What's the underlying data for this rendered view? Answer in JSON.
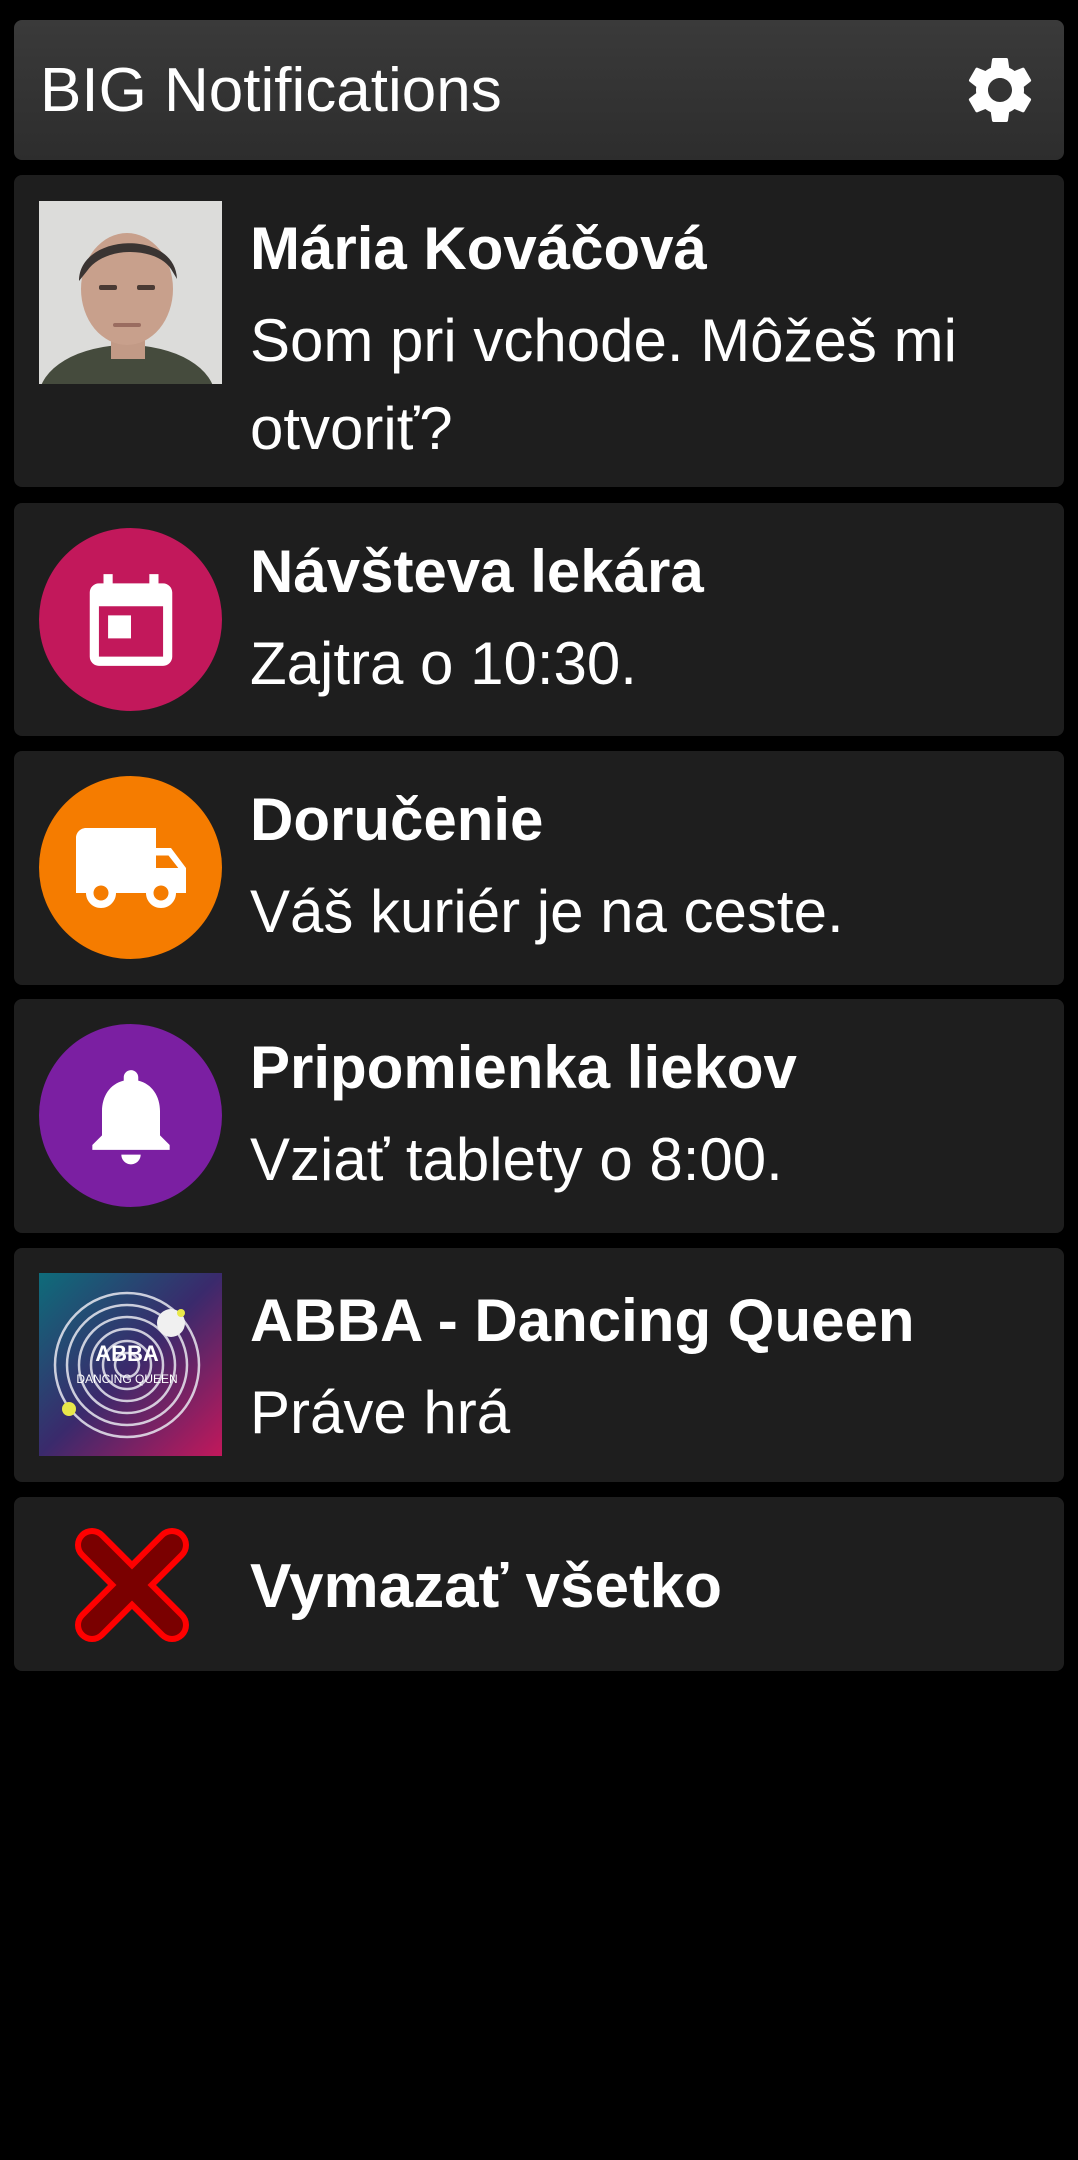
{
  "header": {
    "title": "BIG Notifications",
    "settings_icon": "gear-icon"
  },
  "notifications": [
    {
      "title": "Mária Kováčová",
      "body": "Som pri vchode. Môžeš mi otvoriť?",
      "icon": "contact-photo"
    },
    {
      "title": "Návšteva lekára",
      "body": "Zajtra o 10:30.",
      "icon": "calendar-icon",
      "color": "#c2185b"
    },
    {
      "title": "Doručenie",
      "body": "Váš kuriér je na ceste.",
      "icon": "truck-icon",
      "color": "#f57c00"
    },
    {
      "title": "Pripomienka liekov",
      "body": "Vziať tablety o 8:00.",
      "icon": "bell-icon",
      "color": "#7b1fa2"
    },
    {
      "title": "ABBA - Dancing Queen",
      "body": "Práve hrá",
      "icon": "album-art",
      "album_text": [
        "ABBA",
        "DANCING QUEEN"
      ]
    }
  ],
  "clear_all": {
    "label": "Vymazať všetko",
    "icon": "close-icon",
    "color": "#d50000"
  }
}
